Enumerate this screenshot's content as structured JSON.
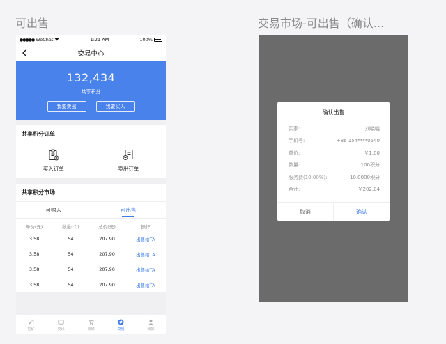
{
  "artboards": {
    "left_title": "可出售",
    "right_title": "交易市场-可出售（确认..."
  },
  "statusbar": {
    "signal": "●●●●●",
    "carrier": "WeChat",
    "time": "1:21 AM",
    "battery": "100%"
  },
  "navbar": {
    "title": "交易中心"
  },
  "hero": {
    "points": "132,434",
    "subtitle": "共享积分",
    "sell_label": "我要卖出",
    "buy_label": "我要买入"
  },
  "orders": {
    "title": "共享积分订单",
    "buy_order_label": "买入订单",
    "sell_order_label": "卖出订单"
  },
  "market": {
    "title": "共享积分市场",
    "tabs": [
      {
        "label": "可购入",
        "active": false
      },
      {
        "label": "可出售",
        "active": true
      }
    ],
    "columns": [
      "单价(元)",
      "数量(个)",
      "总价(元)",
      "操作"
    ],
    "rows": [
      {
        "price": "3.58",
        "qty": "54",
        "total": "207.90",
        "action": "出售给TA"
      },
      {
        "price": "3.58",
        "qty": "54",
        "total": "207.90",
        "action": "出售给TA"
      },
      {
        "price": "3.58",
        "qty": "54",
        "total": "207.90",
        "action": "出售给TA"
      },
      {
        "price": "3.58",
        "qty": "54",
        "total": "207.90",
        "action": "出售给TA"
      }
    ]
  },
  "bottom_nav": [
    {
      "label": "挖矿",
      "icon": "mining-icon",
      "active": false
    },
    {
      "label": "交讯",
      "icon": "news-icon",
      "active": false
    },
    {
      "label": "商城",
      "icon": "cart-icon",
      "active": false
    },
    {
      "label": "交易",
      "icon": "exchange-icon",
      "active": true
    },
    {
      "label": "我的",
      "icon": "user-icon",
      "active": false
    }
  ],
  "dialog": {
    "title": "确认出售",
    "rows": [
      {
        "label": "买家:",
        "value": "刘晓晓"
      },
      {
        "label": "手机号:",
        "value": "+86 154****0540"
      },
      {
        "label": "单价:",
        "value": "￥1.00"
      },
      {
        "label": "数量:",
        "value": "100积分"
      },
      {
        "label": "服务费(10.00%):",
        "value": "10.0000积分"
      },
      {
        "label": "合计:",
        "value": "￥202.04"
      }
    ],
    "cancel_label": "取消",
    "confirm_label": "确认"
  },
  "colors": {
    "accent": "#3d7be6",
    "hero_bg": "#4a82ec",
    "overlay": "#6b6b6b"
  }
}
